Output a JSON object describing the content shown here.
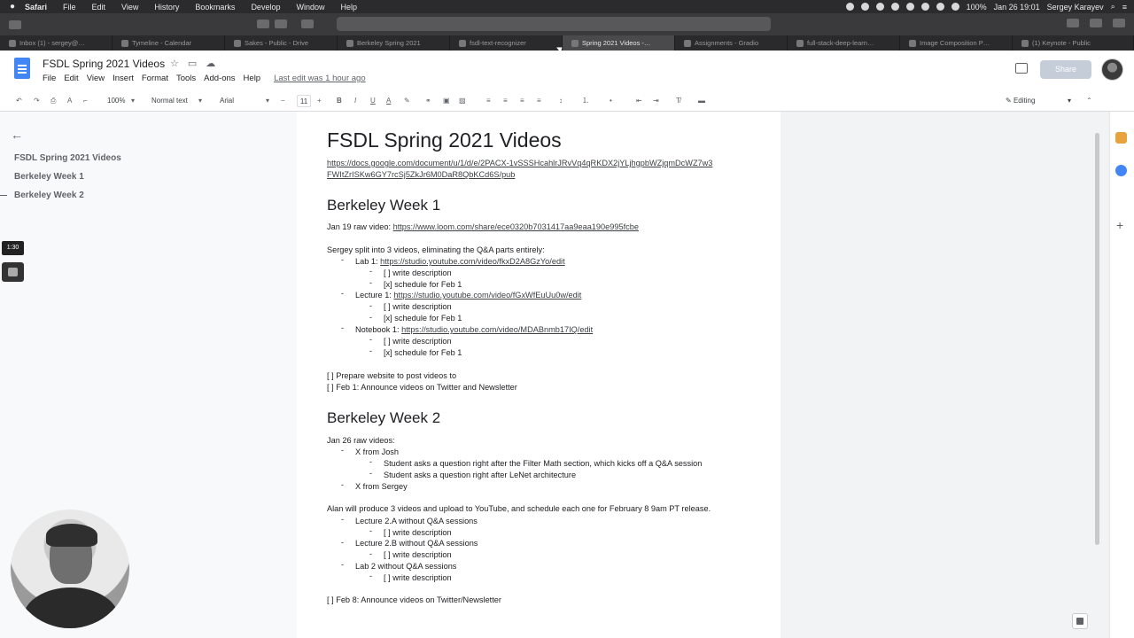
{
  "mac_menu": {
    "items": [
      "Safari",
      "File",
      "Edit",
      "View",
      "History",
      "Bookmarks",
      "Develop",
      "Window",
      "Help"
    ],
    "status": {
      "battery": "100%",
      "datetime": "Jan 26  19:01",
      "user": "Sergey Karayev"
    }
  },
  "tabs": [
    {
      "label": "Inbox (1) - sergey@…",
      "active": false
    },
    {
      "label": "Tymeline - Calendar",
      "active": false
    },
    {
      "label": "Sakes - Public - Drive",
      "active": false
    },
    {
      "label": "Berkeley Spring 2021",
      "active": false
    },
    {
      "label": "fsdl-text-recognizer",
      "active": false
    },
    {
      "label": "Spring 2021 Videos -…",
      "active": true
    },
    {
      "label": "Assignments - Gradio",
      "active": false
    },
    {
      "label": "full-stack-deep-learn…",
      "active": false
    },
    {
      "label": "Image Composition P…",
      "active": false
    },
    {
      "label": "(1) Keynote - Public",
      "active": false
    }
  ],
  "docs": {
    "title": "FSDL Spring 2021 Videos",
    "menu": [
      "File",
      "Edit",
      "View",
      "Insert",
      "Format",
      "Tools",
      "Add-ons",
      "Help"
    ],
    "last_edit": "Last edit was 1 hour ago",
    "share_label": "Share"
  },
  "toolbar": {
    "zoom": "100%",
    "style": "Normal text",
    "font": "Arial",
    "size": "11",
    "mode": "Editing"
  },
  "outline": {
    "items": [
      "FSDL Spring 2021 Videos",
      "Berkeley Week 1",
      "Berkeley Week 2"
    ],
    "timer": "1:30"
  },
  "document": {
    "title": "FSDL Spring 2021 Videos",
    "link": "https://docs.google.com/document/u/1/d/e/2PACX-1vSSSHcahlrJRvVq4qRKDX2jYLjhgpbWZjqmDcWZ7w3",
    "link_cont": "FWItZrISKw6GY7rcSj5ZkJr6M0DaR8QbKCd6S/pub",
    "week1": {
      "heading": "Berkeley Week 1",
      "raw_label": "Jan 19 raw video: ",
      "raw_link": "https://www.loom.com/share/ece0320b7031417aa9eaa190e995fcbe",
      "split": "Sergey split into 3 videos, eliminating the Q&A parts entirely:",
      "lab_label": "Lab 1: ",
      "lab_link": "https://studio.youtube.com/video/fkxD2A8GzYo/edit",
      "lecture_label": "Lecture 1: ",
      "lecture_link": "https://studio.youtube.com/video/fGxWfEuUu0w/edit",
      "notebook_label": "Notebook 1: ",
      "notebook_link": "https://studio.youtube.com/video/MDABnmb17IQ/edit",
      "write_desc": "[ ] write description",
      "schedule": "[x] schedule for Feb 1",
      "prepare": "[ ] Prepare website to post videos to",
      "announce": "[ ] Feb 1: Announce videos on Twitter and Newsletter"
    },
    "week2": {
      "heading": "Berkeley Week 2",
      "raw": "Jan 26 raw videos:",
      "josh": "X from Josh",
      "q1": "Student asks a question right after the Filter Math section, which kicks off a Q&A session",
      "q2": "Student asks a question right after LeNet architecture",
      "sergey": "X from Sergey",
      "alan": "Alan will produce 3 videos and upload to YouTube, and schedule each one for February 8 9am PT release.",
      "lec2a": "Lecture 2.A without Q&A sessions",
      "lec2b": "Lecture 2.B without Q&A sessions",
      "lab2": "Lab 2 without Q&A sessions",
      "write_desc": "[ ] write description",
      "announce": "[ ] Feb 8: Announce videos on Twitter/Newsletter"
    }
  }
}
